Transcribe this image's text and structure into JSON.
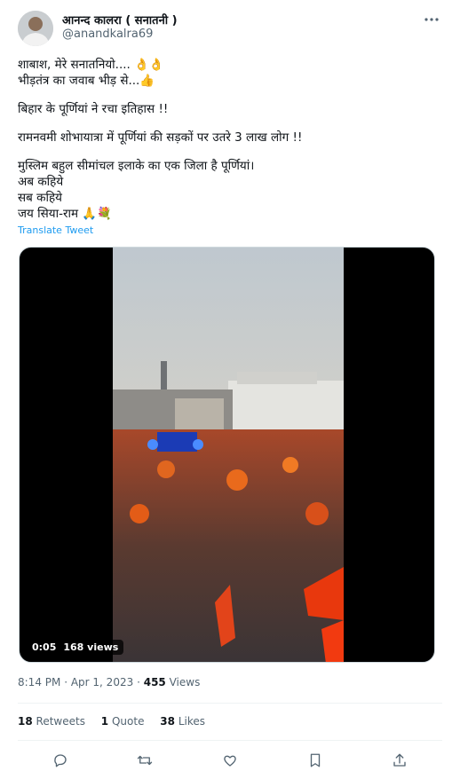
{
  "author": {
    "name": "आनन्द कालरा ( सनातनी )",
    "handle": "@anandkalra69"
  },
  "tweet": {
    "lines": [
      "शाबाश, मेरे सनातनियो.... 👌👌",
      "भीड़तंत्र का जवाब भीड़ से...👍",
      "",
      "बिहार के पूर्णियां ने रचा इतिहास !!",
      "",
      "रामनवमी शोभायात्रा में पूर्णियां की सड़कों पर उतरे 3 लाख लोग !!",
      "",
      "मुस्लिम बहुल सीमांचल इलाके का एक जिला है पूर्णियां।",
      "अब कहिये",
      "सब कहिये",
      "जय सिया-राम 🙏💐"
    ],
    "translate_label": "Translate Tweet"
  },
  "video": {
    "time": "0:05",
    "views": "168 views"
  },
  "meta": {
    "time": "8:14 PM",
    "sep1": "·",
    "date": "Apr 1, 2023",
    "sep2": "·",
    "views_count": "455",
    "views_label": "Views"
  },
  "stats": {
    "retweets_count": "18",
    "retweets_label": "Retweets",
    "quotes_count": "1",
    "quotes_label": "Quote",
    "likes_count": "38",
    "likes_label": "Likes"
  },
  "icons": {
    "more": "more-icon",
    "reply": "reply-icon",
    "retweet": "retweet-icon",
    "like": "heart-icon",
    "bookmark": "bookmark-icon",
    "share": "share-icon"
  },
  "colors": {
    "link": "#1d9bf0",
    "secondary_text": "#536471",
    "primary_text": "#0f1419"
  }
}
